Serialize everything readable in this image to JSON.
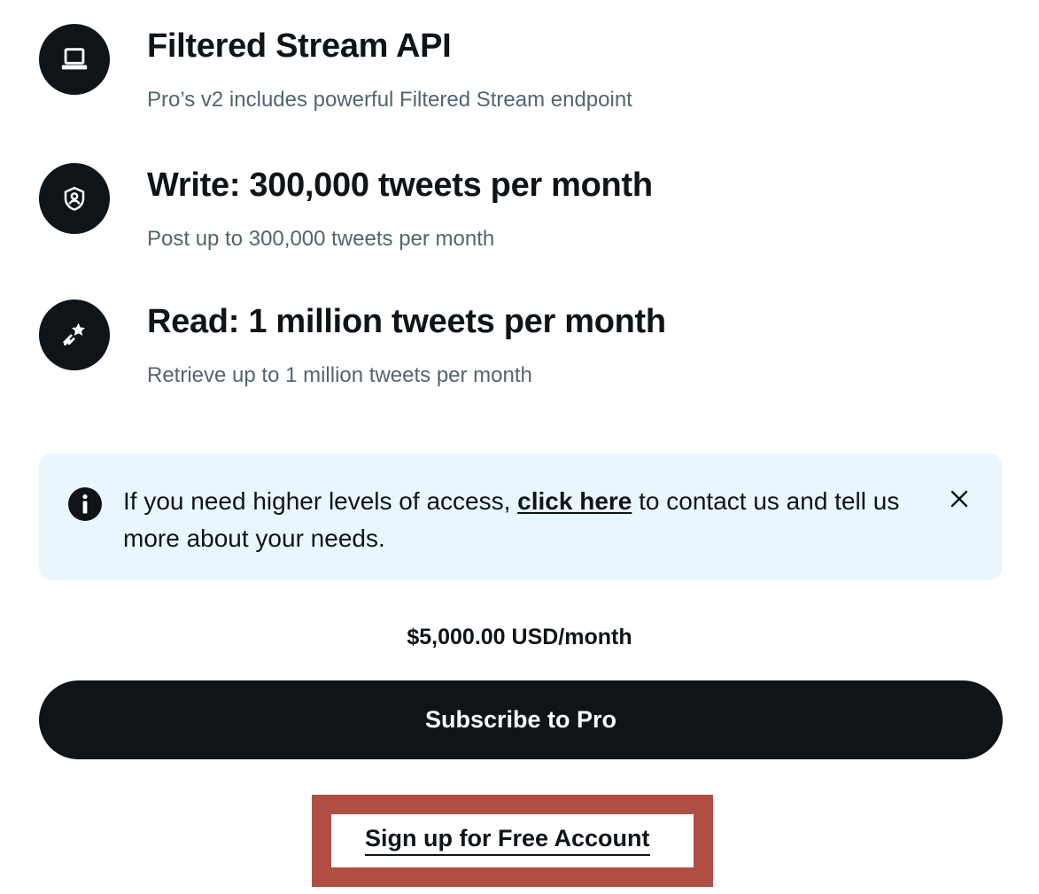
{
  "features": [
    {
      "icon": "laptop-icon",
      "title": "Filtered Stream API",
      "description": "Pro’s v2 includes powerful Filtered Stream endpoint"
    },
    {
      "icon": "shield-user-icon",
      "title": "Write: 300,000 tweets per month",
      "description": "Post up to 300,000 tweets per month"
    },
    {
      "icon": "shooting-star-icon",
      "title": "Read: 1 million tweets per month",
      "description": "Retrieve up to 1 million tweets per month"
    }
  ],
  "alert": {
    "icon": "info-icon",
    "text_before": "If you need higher levels of access, ",
    "link_text": "click here",
    "text_after": " to contact us and tell us more about your needs.",
    "close_icon": "close-icon",
    "background": "#eaf6fd"
  },
  "pricing": {
    "price": "$5,000.00 USD/month"
  },
  "actions": {
    "subscribe_label": "Subscribe to Pro",
    "signup_label": "Sign up for Free Account"
  },
  "colors": {
    "primary": "#0f1419",
    "secondary_text": "#536471",
    "highlight_border": "#b14e44"
  }
}
